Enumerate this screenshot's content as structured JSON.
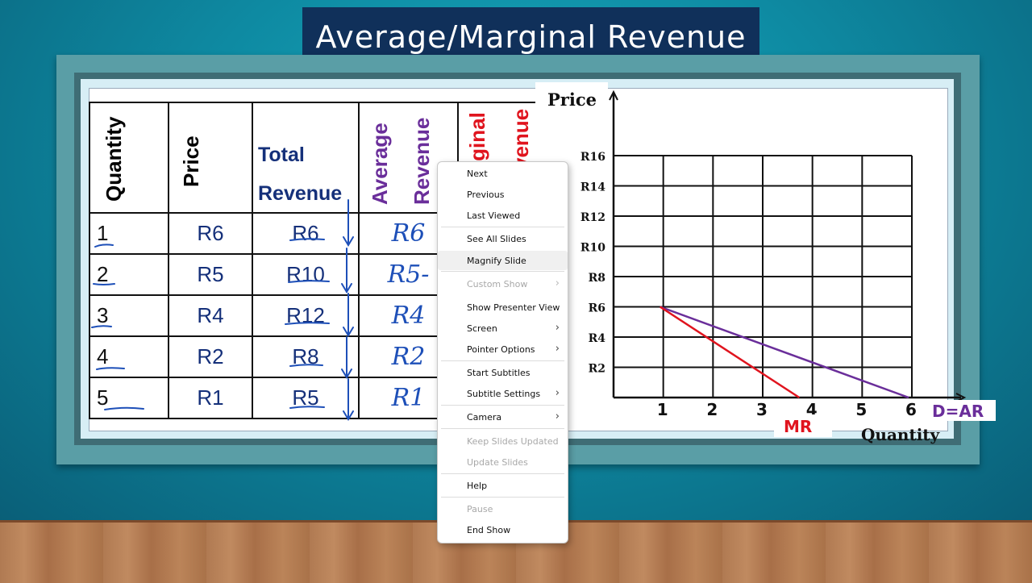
{
  "title": "Average/Marginal Revenue",
  "table": {
    "headers": {
      "quantity": "Quantity",
      "price": "Price",
      "total_revenue_line1": "Total",
      "total_revenue_line2": "Revenue",
      "average_line1": "Average",
      "average_line2": "Revenue",
      "marginal_line1": "rginal",
      "marginal_line2": "venue"
    },
    "rows": [
      {
        "quantity": "1",
        "price": "R6",
        "total": "R6",
        "average": "R6"
      },
      {
        "quantity": "2",
        "price": "R5",
        "total": "R10",
        "average": "R5-"
      },
      {
        "quantity": "3",
        "price": "R4",
        "total": "R12",
        "average": "R4"
      },
      {
        "quantity": "4",
        "price": "R2",
        "total": "R8",
        "average": "R2"
      },
      {
        "quantity": "5",
        "price": "R1",
        "total": "R5",
        "average": "R1"
      }
    ]
  },
  "chart_data": {
    "type": "line",
    "ylabel": "Price",
    "xlabel": "Quantity",
    "y_ticks": [
      "R2",
      "R4",
      "R6",
      "R8",
      "R10",
      "R12",
      "R14",
      "R16"
    ],
    "x_ticks": [
      "1",
      "2",
      "3",
      "4",
      "5",
      "6"
    ],
    "xlim": [
      0,
      6.5
    ],
    "ylim": [
      0,
      16
    ],
    "grid": true,
    "series": [
      {
        "name": "D=AR",
        "color": "#6a2e9a",
        "x": [
          1,
          6
        ],
        "y": [
          6,
          0
        ]
      },
      {
        "name": "MR",
        "color": "#e0141e",
        "x": [
          1,
          3.8
        ],
        "y": [
          6,
          0
        ]
      }
    ]
  },
  "context_menu": {
    "items": [
      {
        "label": "Next",
        "disabled": false,
        "submenu": false
      },
      {
        "label": "Previous",
        "disabled": false,
        "submenu": false
      },
      {
        "label": "Last Viewed",
        "disabled": false,
        "submenu": false
      },
      {
        "label": "See All Slides",
        "disabled": false,
        "submenu": false
      },
      {
        "label": "Magnify Slide",
        "disabled": false,
        "submenu": false
      },
      {
        "label": "Custom Show",
        "disabled": true,
        "submenu": true
      },
      {
        "label": "Show Presenter View",
        "disabled": false,
        "submenu": false
      },
      {
        "label": "Screen",
        "disabled": false,
        "submenu": true
      },
      {
        "label": "Pointer Options",
        "disabled": false,
        "submenu": true
      },
      {
        "label": "Start Subtitles",
        "disabled": false,
        "submenu": false
      },
      {
        "label": "Subtitle Settings",
        "disabled": false,
        "submenu": true
      },
      {
        "label": "Camera",
        "disabled": false,
        "submenu": true
      },
      {
        "label": "Keep Slides Updated",
        "disabled": true,
        "submenu": false
      },
      {
        "label": "Update Slides",
        "disabled": true,
        "submenu": false
      },
      {
        "label": "Help",
        "disabled": false,
        "submenu": false
      },
      {
        "label": "Pause",
        "disabled": true,
        "submenu": false
      },
      {
        "label": "End Show",
        "disabled": false,
        "submenu": false
      }
    ]
  },
  "colors": {
    "banner": "#10305a",
    "navy_text": "#15307a",
    "purple": "#6a2e9a",
    "red": "#e0141e",
    "ink_blue": "#1d4fb8"
  }
}
